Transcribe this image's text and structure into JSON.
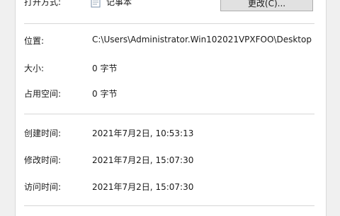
{
  "properties": {
    "open_with_label": "打开方式:",
    "open_with_icon": "notepad-icon",
    "open_with_app": "记事本",
    "change_button": "更改(C)...",
    "rows": [
      {
        "label": "位置:",
        "value": "C:\\Users\\Administrator.Win102021VPXFOO\\Desktop"
      },
      {
        "label": "大小:",
        "value": "0 字节"
      },
      {
        "label": "占用空间:",
        "value": "0 字节"
      },
      {
        "label": "创建时间:",
        "value": "2021年7月2日, 10:53:13"
      },
      {
        "label": "修改时间:",
        "value": "2021年7月2日, 15:07:30"
      },
      {
        "label": "访问时间:",
        "value": "2021年7月2日, 15:07:30"
      }
    ]
  }
}
